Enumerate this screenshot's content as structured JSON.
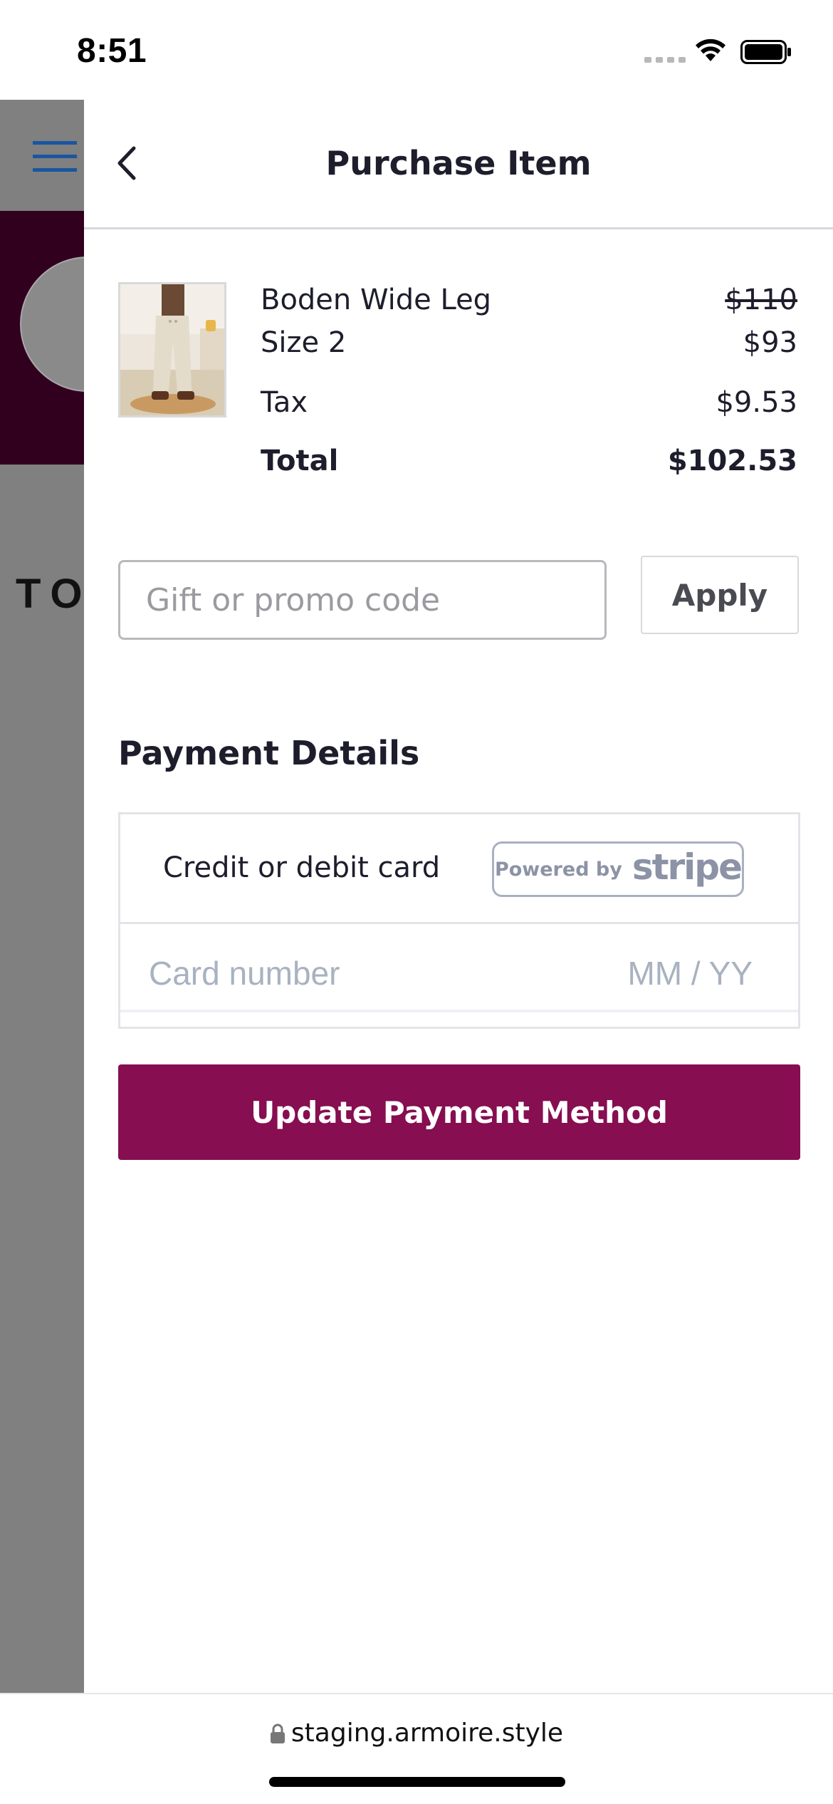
{
  "status_bar": {
    "time": "8:51"
  },
  "background": {
    "partial_heading": "TO"
  },
  "header": {
    "title": "Purchase Item"
  },
  "order": {
    "product_name": "Boden Wide Leg",
    "original_price": "$110",
    "size": "Size 2",
    "price": "$93",
    "tax_label": "Tax",
    "tax_value": "$9.53",
    "total_label": "Total",
    "total_value": "$102.53"
  },
  "promo": {
    "placeholder": "Gift or promo code",
    "apply_label": "Apply"
  },
  "payment": {
    "section_title": "Payment Details",
    "card_label": "Credit or debit card",
    "powered_by": "Powered by",
    "stripe": "stripe",
    "card_number_placeholder": "Card number",
    "expiry_placeholder": "MM / YY",
    "update_button": "Update Payment Method"
  },
  "browser": {
    "url": "staging.armoire.style"
  },
  "colors": {
    "brand": "#860e51",
    "banner": "#32001f",
    "overlay": "#808080",
    "menu_icon": "#1a56a0"
  }
}
